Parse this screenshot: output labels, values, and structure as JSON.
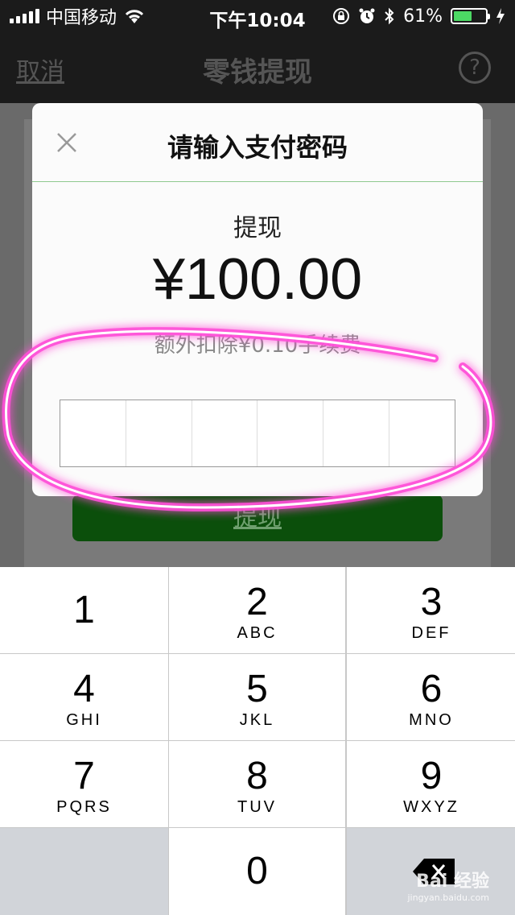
{
  "status_bar": {
    "carrier": "中国移动",
    "time": "下午10:04",
    "battery_percent": "61%",
    "battery_level": 0.61,
    "icons": [
      "signal-icon",
      "wifi-icon",
      "rotation-lock-icon",
      "alarm-icon",
      "bluetooth-icon",
      "battery-icon",
      "charging-icon"
    ]
  },
  "nav": {
    "cancel_label": "取消",
    "title": "零钱提现",
    "help_label": "?"
  },
  "background": {
    "withdraw_button_label": "提现"
  },
  "dialog": {
    "title": "请输入支付密码",
    "close_icon": "close-icon",
    "label": "提现",
    "amount": "¥100.00",
    "fee_note": "额外扣除¥0.10手续费",
    "pin_length": 6
  },
  "keypad": {
    "keys": [
      {
        "digit": "1",
        "letters": ""
      },
      {
        "digit": "2",
        "letters": "ABC"
      },
      {
        "digit": "3",
        "letters": "DEF"
      },
      {
        "digit": "4",
        "letters": "GHI"
      },
      {
        "digit": "5",
        "letters": "JKL"
      },
      {
        "digit": "6",
        "letters": "MNO"
      },
      {
        "digit": "7",
        "letters": "PQRS"
      },
      {
        "digit": "8",
        "letters": "TUV"
      },
      {
        "digit": "9",
        "letters": "WXYZ"
      },
      {
        "digit": "0",
        "letters": ""
      }
    ],
    "delete_icon": "backspace-icon"
  },
  "colors": {
    "accent_green": "#0b4f0b",
    "highlight_pink": "#ff4fd8",
    "battery_green": "#4cd964"
  }
}
